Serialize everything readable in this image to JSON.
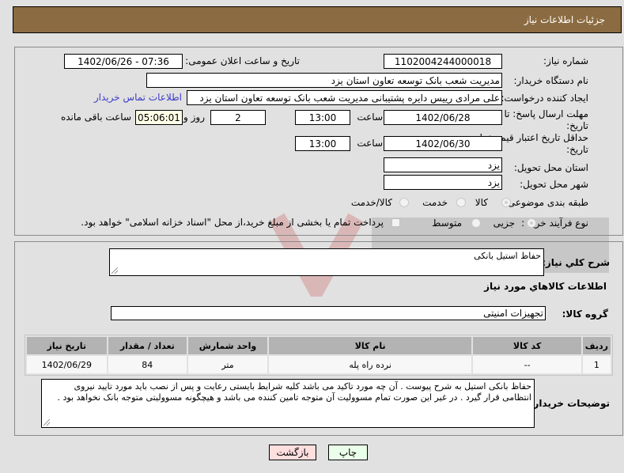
{
  "header": {
    "title": "جزئیات اطلاعات نیاز"
  },
  "form": {
    "need_number": {
      "label": "شماره نیاز:",
      "value": "1102004244000018"
    },
    "announce_datetime": {
      "label": "تاریخ و ساعت اعلان عمومی:",
      "value": "1402/06/26 - 07:36"
    },
    "buyer_org": {
      "label": "نام دستگاه خریدار:",
      "value": "مدیریت شعب بانک توسعه تعاون استان یزد"
    },
    "requester": {
      "label": "ایجاد کننده درخواست:",
      "value": "علی مرادی رییس دایره پشتیبانی مدیریت شعب بانک توسعه تعاون استان یزد",
      "contact_link": "اطلاعات تماس خریدار"
    },
    "reply_deadline": {
      "label_line1": "مهلت ارسال پاسخ: تا",
      "label_line2": "تاریخ:",
      "date": "1402/06/28",
      "time_label": "ساعت",
      "time": "13:00",
      "days": "2",
      "days_label": "روز و",
      "remaining": "05:06:01",
      "remaining_label": "ساعت باقی مانده"
    },
    "price_validity": {
      "label_line1": "حداقل تاریخ اعتبار قیمت: تا",
      "label_line2": "تاریخ:",
      "date": "1402/06/30",
      "time_label": "ساعت",
      "time": "13:00"
    },
    "delivery_province": {
      "label": "استان محل تحویل:",
      "value": "یزد"
    },
    "delivery_city": {
      "label": "شهر محل تحویل:",
      "value": "یزد"
    },
    "category": {
      "label": "طبقه بندی موضوعی:",
      "options": [
        "کالا",
        "خدمت",
        "کالا/خدمت"
      ],
      "selected": "کالا"
    },
    "purchase_type": {
      "label": "نوع فرآیند خرید :",
      "options": [
        "جزیی",
        "متوسط"
      ],
      "selected": "جزیی",
      "treasury_checkbox": "پرداخت تمام یا بخشی از مبلغ خرید،از محل \"اسناد خزانه اسلامی\" خواهد بود."
    }
  },
  "details": {
    "summary_label": "شرح کلي نياز:",
    "summary_value": "حفاظ استیل بانکی",
    "goods_info_title": "اطلاعات کالاهاي مورد نياز",
    "goods_group_label": "گروه کالا:",
    "goods_group_value": "تجهیزات امنیتی",
    "table": {
      "headers": [
        "ردیف",
        "کد کالا",
        "نام کالا",
        "واحد شمارش",
        "تعداد / مقدار",
        "تاریخ نیاز"
      ],
      "rows": [
        [
          "1",
          "--",
          "نرده راه پله",
          "متر",
          "84",
          "1402/06/29"
        ]
      ]
    },
    "buyer_notes_label": "توضیحات خریدار:",
    "buyer_notes_value": "حفاظ بانکی استیل به شرح پیوست . آن چه مورد تاکید می باشد کلیه شرایط بایستی رعایت و پس از نصب باید مورد تایید نیروی انتظامی قرار گیرد . در غیر این صورت تمام مسوولیت آن متوجه تامین کننده می باشد و هیچگونه مسوولیتی متوجه بانک نخواهد بود ."
  },
  "buttons": {
    "print": "چاپ",
    "back": "بازگشت"
  },
  "colors": {
    "header_bg": "#8b6b41",
    "link": "#3b3bc8",
    "print_bg": "#eaffea",
    "back_bg": "#ffdede"
  }
}
